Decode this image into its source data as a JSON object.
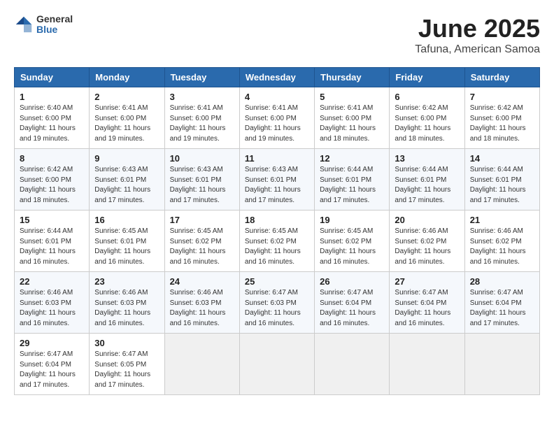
{
  "logo": {
    "general": "General",
    "blue": "Blue"
  },
  "header": {
    "month": "June 2025",
    "location": "Tafuna, American Samoa"
  },
  "days_of_week": [
    "Sunday",
    "Monday",
    "Tuesday",
    "Wednesday",
    "Thursday",
    "Friday",
    "Saturday"
  ],
  "weeks": [
    [
      {
        "day": "1",
        "sunrise": "Sunrise: 6:40 AM",
        "sunset": "Sunset: 6:00 PM",
        "daylight": "Daylight: 11 hours and 19 minutes."
      },
      {
        "day": "2",
        "sunrise": "Sunrise: 6:41 AM",
        "sunset": "Sunset: 6:00 PM",
        "daylight": "Daylight: 11 hours and 19 minutes."
      },
      {
        "day": "3",
        "sunrise": "Sunrise: 6:41 AM",
        "sunset": "Sunset: 6:00 PM",
        "daylight": "Daylight: 11 hours and 19 minutes."
      },
      {
        "day": "4",
        "sunrise": "Sunrise: 6:41 AM",
        "sunset": "Sunset: 6:00 PM",
        "daylight": "Daylight: 11 hours and 19 minutes."
      },
      {
        "day": "5",
        "sunrise": "Sunrise: 6:41 AM",
        "sunset": "Sunset: 6:00 PM",
        "daylight": "Daylight: 11 hours and 18 minutes."
      },
      {
        "day": "6",
        "sunrise": "Sunrise: 6:42 AM",
        "sunset": "Sunset: 6:00 PM",
        "daylight": "Daylight: 11 hours and 18 minutes."
      },
      {
        "day": "7",
        "sunrise": "Sunrise: 6:42 AM",
        "sunset": "Sunset: 6:00 PM",
        "daylight": "Daylight: 11 hours and 18 minutes."
      }
    ],
    [
      {
        "day": "8",
        "sunrise": "Sunrise: 6:42 AM",
        "sunset": "Sunset: 6:00 PM",
        "daylight": "Daylight: 11 hours and 18 minutes."
      },
      {
        "day": "9",
        "sunrise": "Sunrise: 6:43 AM",
        "sunset": "Sunset: 6:01 PM",
        "daylight": "Daylight: 11 hours and 17 minutes."
      },
      {
        "day": "10",
        "sunrise": "Sunrise: 6:43 AM",
        "sunset": "Sunset: 6:01 PM",
        "daylight": "Daylight: 11 hours and 17 minutes."
      },
      {
        "day": "11",
        "sunrise": "Sunrise: 6:43 AM",
        "sunset": "Sunset: 6:01 PM",
        "daylight": "Daylight: 11 hours and 17 minutes."
      },
      {
        "day": "12",
        "sunrise": "Sunrise: 6:44 AM",
        "sunset": "Sunset: 6:01 PM",
        "daylight": "Daylight: 11 hours and 17 minutes."
      },
      {
        "day": "13",
        "sunrise": "Sunrise: 6:44 AM",
        "sunset": "Sunset: 6:01 PM",
        "daylight": "Daylight: 11 hours and 17 minutes."
      },
      {
        "day": "14",
        "sunrise": "Sunrise: 6:44 AM",
        "sunset": "Sunset: 6:01 PM",
        "daylight": "Daylight: 11 hours and 17 minutes."
      }
    ],
    [
      {
        "day": "15",
        "sunrise": "Sunrise: 6:44 AM",
        "sunset": "Sunset: 6:01 PM",
        "daylight": "Daylight: 11 hours and 16 minutes."
      },
      {
        "day": "16",
        "sunrise": "Sunrise: 6:45 AM",
        "sunset": "Sunset: 6:01 PM",
        "daylight": "Daylight: 11 hours and 16 minutes."
      },
      {
        "day": "17",
        "sunrise": "Sunrise: 6:45 AM",
        "sunset": "Sunset: 6:02 PM",
        "daylight": "Daylight: 11 hours and 16 minutes."
      },
      {
        "day": "18",
        "sunrise": "Sunrise: 6:45 AM",
        "sunset": "Sunset: 6:02 PM",
        "daylight": "Daylight: 11 hours and 16 minutes."
      },
      {
        "day": "19",
        "sunrise": "Sunrise: 6:45 AM",
        "sunset": "Sunset: 6:02 PM",
        "daylight": "Daylight: 11 hours and 16 minutes."
      },
      {
        "day": "20",
        "sunrise": "Sunrise: 6:46 AM",
        "sunset": "Sunset: 6:02 PM",
        "daylight": "Daylight: 11 hours and 16 minutes."
      },
      {
        "day": "21",
        "sunrise": "Sunrise: 6:46 AM",
        "sunset": "Sunset: 6:02 PM",
        "daylight": "Daylight: 11 hours and 16 minutes."
      }
    ],
    [
      {
        "day": "22",
        "sunrise": "Sunrise: 6:46 AM",
        "sunset": "Sunset: 6:03 PM",
        "daylight": "Daylight: 11 hours and 16 minutes."
      },
      {
        "day": "23",
        "sunrise": "Sunrise: 6:46 AM",
        "sunset": "Sunset: 6:03 PM",
        "daylight": "Daylight: 11 hours and 16 minutes."
      },
      {
        "day": "24",
        "sunrise": "Sunrise: 6:46 AM",
        "sunset": "Sunset: 6:03 PM",
        "daylight": "Daylight: 11 hours and 16 minutes."
      },
      {
        "day": "25",
        "sunrise": "Sunrise: 6:47 AM",
        "sunset": "Sunset: 6:03 PM",
        "daylight": "Daylight: 11 hours and 16 minutes."
      },
      {
        "day": "26",
        "sunrise": "Sunrise: 6:47 AM",
        "sunset": "Sunset: 6:04 PM",
        "daylight": "Daylight: 11 hours and 16 minutes."
      },
      {
        "day": "27",
        "sunrise": "Sunrise: 6:47 AM",
        "sunset": "Sunset: 6:04 PM",
        "daylight": "Daylight: 11 hours and 16 minutes."
      },
      {
        "day": "28",
        "sunrise": "Sunrise: 6:47 AM",
        "sunset": "Sunset: 6:04 PM",
        "daylight": "Daylight: 11 hours and 17 minutes."
      }
    ],
    [
      {
        "day": "29",
        "sunrise": "Sunrise: 6:47 AM",
        "sunset": "Sunset: 6:04 PM",
        "daylight": "Daylight: 11 hours and 17 minutes."
      },
      {
        "day": "30",
        "sunrise": "Sunrise: 6:47 AM",
        "sunset": "Sunset: 6:05 PM",
        "daylight": "Daylight: 11 hours and 17 minutes."
      },
      null,
      null,
      null,
      null,
      null
    ]
  ]
}
